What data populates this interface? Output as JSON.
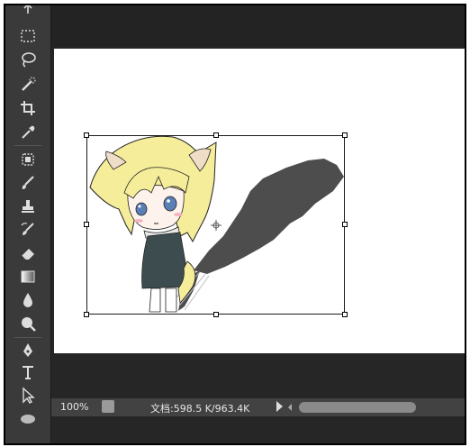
{
  "status": {
    "zoom": "100%",
    "doc_info": "文档:598.5 K/963.4K"
  },
  "tools": [
    "move-icon",
    "marquee-icon",
    "lasso-icon",
    "quick-select-icon",
    "crop-icon",
    "eyedropper-icon",
    "healing-icon",
    "brush-icon",
    "stamp-icon",
    "history-brush-icon",
    "eraser-icon",
    "gradient-icon",
    "blur-icon",
    "dodge-icon",
    "pen-icon",
    "type-icon",
    "path-select-icon",
    "ellipse-icon"
  ],
  "canvas": {
    "background": "#ffffff",
    "shadow_color": "#4d4d4d"
  }
}
